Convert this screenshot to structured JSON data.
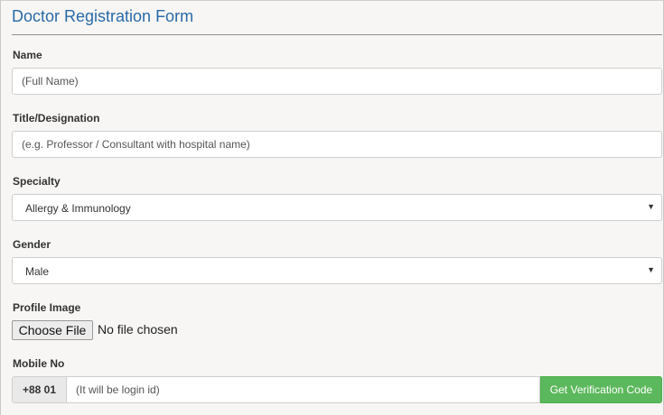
{
  "form": {
    "title": "Doctor Registration Form",
    "name": {
      "label": "Name",
      "placeholder": "(Full Name)"
    },
    "designation": {
      "label": "Title/Designation",
      "placeholder": "(e.g. Professor / Consultant with hospital name)"
    },
    "specialty": {
      "label": "Specialty",
      "selected": "Allergy & Immunology"
    },
    "gender": {
      "label": "Gender",
      "selected": "Male"
    },
    "profile_image": {
      "label": "Profile Image",
      "button": "Choose File",
      "status": "No file chosen"
    },
    "mobile": {
      "label": "Mobile No",
      "prefix": "+88 01",
      "placeholder": "(It will be login id)",
      "verify_button": "Get Verification Code"
    }
  },
  "colors": {
    "title": "#2a6aa8",
    "verify_button": "#5cb85c",
    "background": "#f7f6f4"
  },
  "icons": {
    "select_caret": "caret-down-icon"
  }
}
